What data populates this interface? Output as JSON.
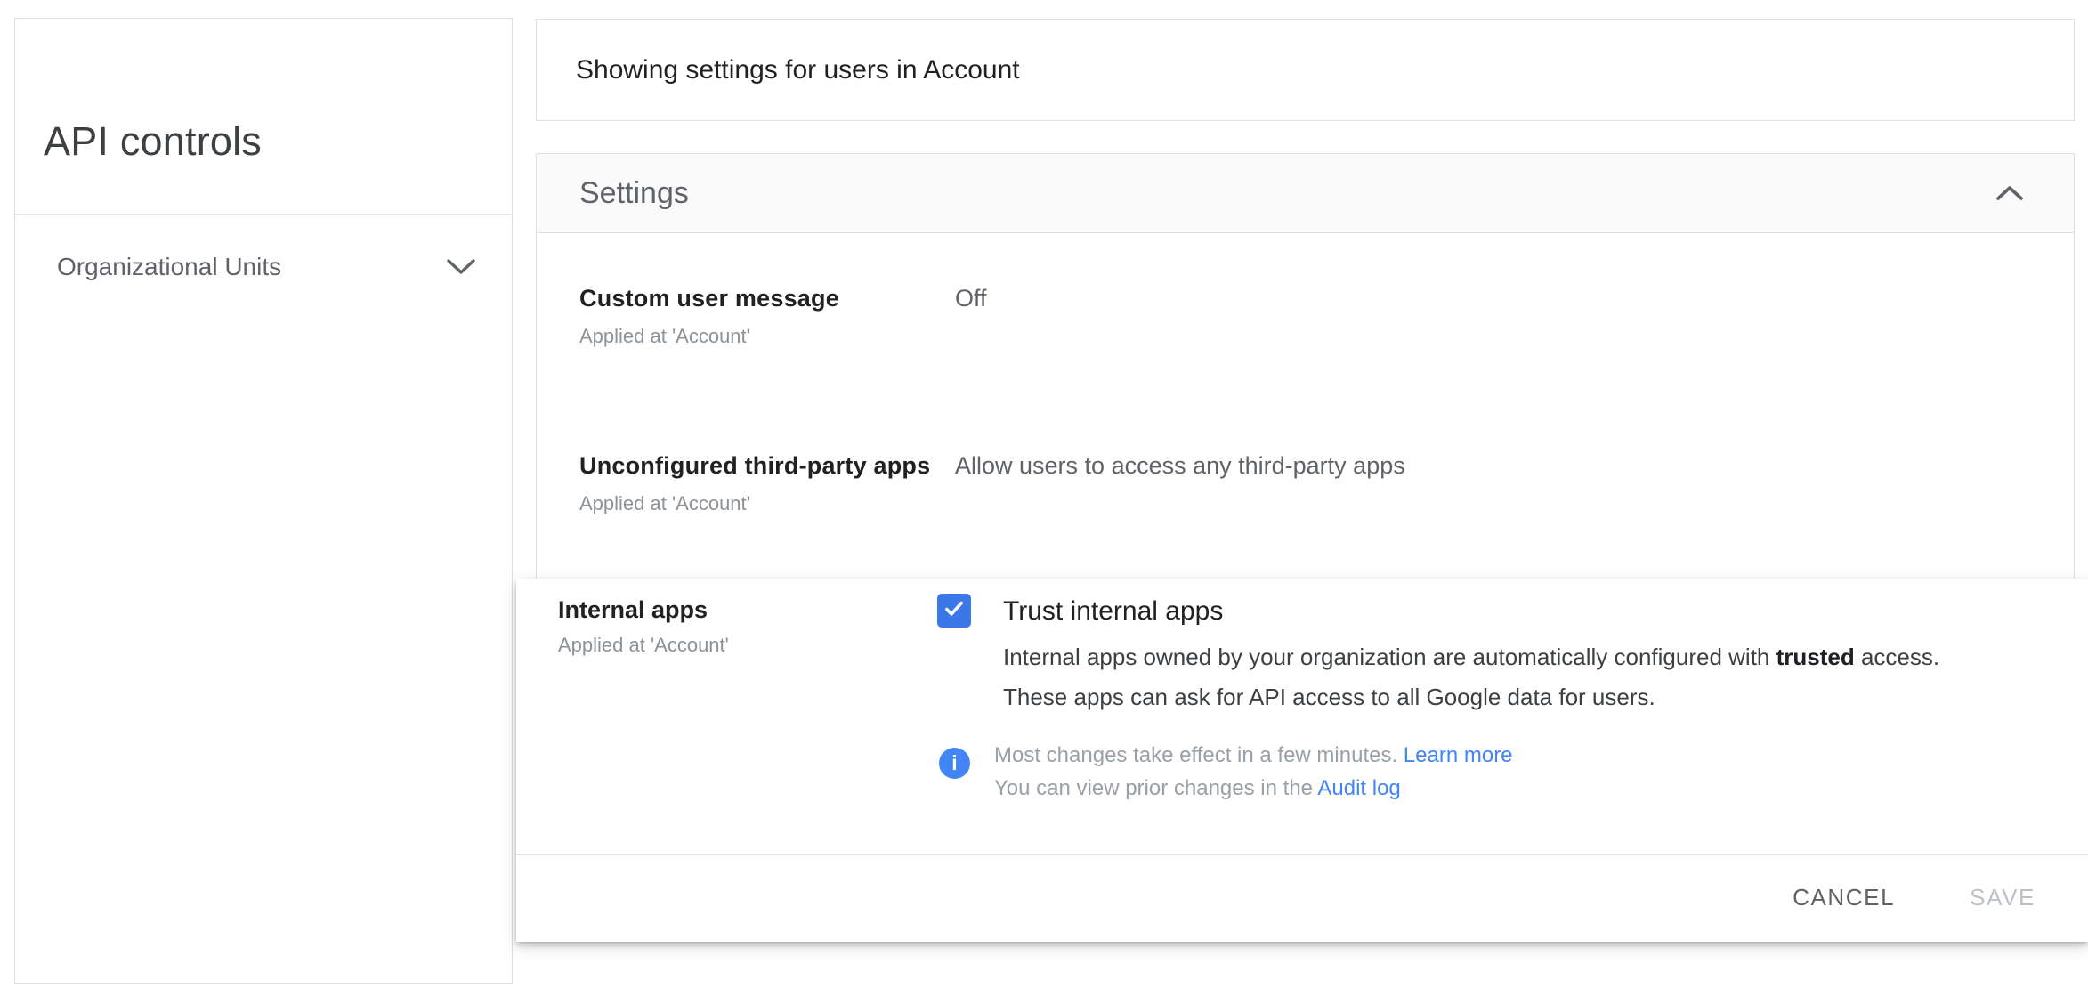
{
  "sidebar": {
    "title": "API controls",
    "org_units": {
      "label": "Organizational Units"
    }
  },
  "topbar": {
    "scope_text": "Showing settings for users in Account"
  },
  "settings_panel": {
    "header": "Settings",
    "rows": [
      {
        "title": "Custom user message",
        "applied": "Applied at 'Account'",
        "value": "Off"
      },
      {
        "title": "Unconfigured third-party apps",
        "applied": "Applied at 'Account'",
        "value": "Allow users to access any third-party apps"
      }
    ]
  },
  "internal_apps_card": {
    "title": "Internal apps",
    "applied": "Applied at 'Account'",
    "checkbox": {
      "checked": true,
      "label": "Trust internal apps"
    },
    "description": {
      "line1_prefix": "Internal apps owned by your organization are automatically configured with ",
      "line1_bold": "trusted",
      "line1_suffix": " access.",
      "line2": "These apps can ask for API access to all Google data for users."
    },
    "info": {
      "line1_text": "Most changes take effect in a few minutes. ",
      "line1_link": "Learn more",
      "line2_text": "You can view prior changes in the ",
      "line2_link": "Audit log"
    },
    "buttons": {
      "cancel": "CANCEL",
      "save": "SAVE"
    }
  },
  "icons": {
    "org_units_expander": "chevron-down-icon",
    "settings_collapse": "chevron-up-icon",
    "trust_checkbox": "checkbox-checked-icon",
    "info_note": "info-icon"
  },
  "colors": {
    "checkbox_blue": "#3b78e7",
    "link_blue": "#4285f4",
    "info_icon_blue": "#4285f4",
    "header_gray_bg": "#fafafa",
    "save_disabled": "#bdc1c6"
  }
}
